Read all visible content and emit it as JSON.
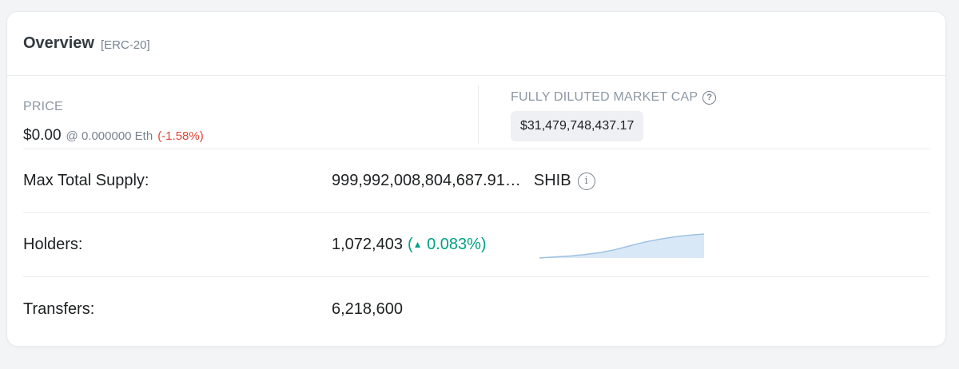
{
  "header": {
    "title": "Overview",
    "subtitle": "[ERC-20]"
  },
  "price": {
    "label": "PRICE",
    "value": "$0.00",
    "eth": "@ 0.000000 Eth",
    "change": "(-1.58%)"
  },
  "market_cap": {
    "label": "FULLY DILUTED MARKET CAP",
    "help_icon": "question-circle-icon",
    "value": "$31,479,748,437.17"
  },
  "rows": {
    "supply": {
      "label": "Max Total Supply:",
      "value": "999,992,008,804,687.91…",
      "unit": "SHIB",
      "info_icon": "info-circle-icon"
    },
    "holders": {
      "label": "Holders:",
      "value": "1,072,403",
      "change_open": "(",
      "caret": "▲",
      "change": " 0.083%)",
      "trend": [
        0.0,
        0.04,
        0.08,
        0.14,
        0.22,
        0.34,
        0.5,
        0.66,
        0.78,
        0.88,
        0.95,
        1.0
      ]
    },
    "transfers": {
      "label": "Transfers:",
      "value": "6,218,600"
    }
  },
  "colors": {
    "negative": "#de4437",
    "positive": "#00a186",
    "sparkline_fill": "#d9e8f6",
    "sparkline_stroke": "#9fc1e3"
  }
}
